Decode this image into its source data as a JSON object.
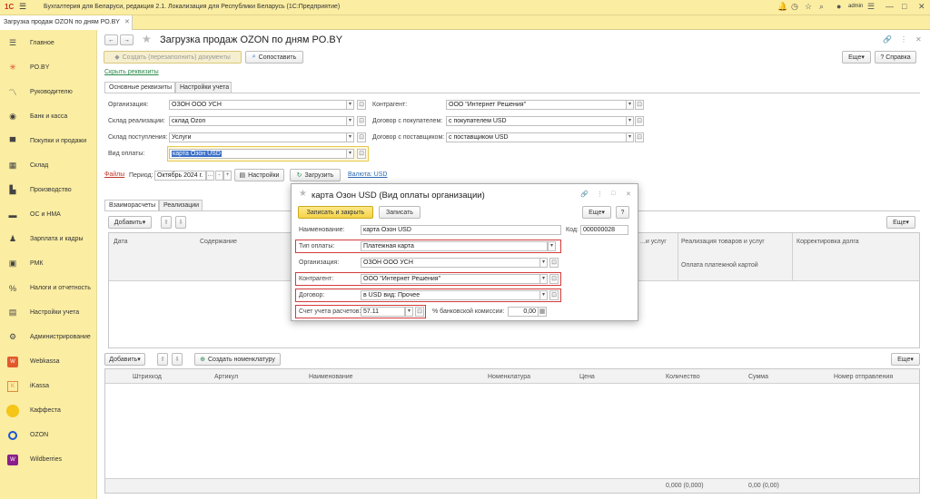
{
  "app": {
    "title": "Бухгалтерия для Беларуси, редакция 2.1. Локализация для Республики Беларусь   (1С:Предприятие)",
    "user": "admin",
    "tab": "Загрузка продаж OZON по дням PO.BY"
  },
  "sidebar": {
    "items": [
      {
        "label": "Главное",
        "icon": "hamburger-icon"
      },
      {
        "label": "PO.BY",
        "icon": "asterisk-icon"
      },
      {
        "label": "Руководителю",
        "icon": "chart-line-icon"
      },
      {
        "label": "Банк и касса",
        "icon": "bank-icon"
      },
      {
        "label": "Покупки и продажи",
        "icon": "cart-icon"
      },
      {
        "label": "Склад",
        "icon": "warehouse-icon"
      },
      {
        "label": "Производство",
        "icon": "factory-icon"
      },
      {
        "label": "ОС и НМА",
        "icon": "truck-icon"
      },
      {
        "label": "Зарплата и кадры",
        "icon": "person-icon"
      },
      {
        "label": "РМК",
        "icon": "register-icon"
      },
      {
        "label": "Налоги и отчетность",
        "icon": "percent-icon"
      },
      {
        "label": "Настройки учета",
        "icon": "book-icon"
      },
      {
        "label": "Администрирование",
        "icon": "gear-icon"
      },
      {
        "label": "Webkassa",
        "icon": "webkassa-icon"
      },
      {
        "label": "iKassa",
        "icon": "ikassa-icon"
      },
      {
        "label": "Каффеста",
        "icon": "kaffesta-icon"
      },
      {
        "label": "OZON",
        "icon": "ozon-icon"
      },
      {
        "label": "Wildberries",
        "icon": "wildberries-icon"
      }
    ]
  },
  "doc": {
    "title": "Загрузка продаж OZON по дням PO.BY",
    "create_btn": "Создать (перезаполнить) документы",
    "compare_btn": "Сопоставить",
    "more_btn": "Еще",
    "help_btn": "Справка",
    "hide_link": "Скрыть реквизиты",
    "tabs": [
      "Основные реквизиты",
      "Настройки учета"
    ],
    "org_label": "Организация:",
    "org_value": "ОЗОН ООО УСН",
    "store_sale_label": "Склад реализации:",
    "store_sale_value": "склад Ozon",
    "store_in_label": "Склад поступления:",
    "store_in_value": "Услуги",
    "pay_label": "Вид оплаты:",
    "pay_value": "карта Озон USD",
    "counter_label": "Контрагент:",
    "counter_value": "ООО \"Интернет Решения\"",
    "buyer_label": "Договор с покупателем:",
    "buyer_value": "с покупателем USD",
    "supplier_label": "Договор с поставщиком:",
    "supplier_value": "с поставщиком USD",
    "files_link": "Файлы",
    "period_label": "Период:",
    "period_value": "Октябрь 2024 г.",
    "settings_btn": "Настройки",
    "load_btn": "Загрузить",
    "currency_link": "Валюта: USD",
    "tabs2": [
      "Взаиморасчеты",
      "Реализации"
    ],
    "add_btn": "Добавить",
    "grid1_headers": {
      "date": "Дата",
      "content": "Содержание",
      "services": "...и услуг",
      "realization": "Реализация товаров и услуг",
      "card_payment": "Оплата платежной картой",
      "debt": "Корректировка долга"
    },
    "create_nom_btn": "Создать номенклатуру",
    "grid2_headers": [
      "Штрихкод",
      "Артикул",
      "Наименование",
      "Номенклатура",
      "Цена",
      "Количество",
      "Сумма",
      "Номер отправления"
    ],
    "qty_total": "0,000 (0,000)",
    "sum_total": "0,00 (0,00)"
  },
  "dialog": {
    "title": "карта Озон USD (Вид оплаты организации)",
    "save_close_btn": "Записать и закрыть",
    "save_btn": "Записать",
    "more_btn": "Еще",
    "help_btn": "?",
    "name_label": "Наименование:",
    "name_value": "карта Озон USD",
    "code_label": "Код:",
    "code_value": "000000028",
    "type_label": "Тип оплаты:",
    "type_value": "Платежная карта",
    "org_label": "Организация:",
    "org_value": "ОЗОН ООО УСН",
    "counter_label": "Контрагент:",
    "counter_value": "ООО \"Интернет Решения\"",
    "contract_label": "Договор:",
    "contract_value": "в USD вид: Прочее",
    "account_label": "Счет учета расчетов:",
    "account_value": "57.11",
    "commission_label": "% банковской комиссии:",
    "commission_value": "0,00"
  },
  "colors": {
    "accent": "#fbeda2",
    "highlight": "#d33b3b",
    "link": "#2a6bb3"
  }
}
